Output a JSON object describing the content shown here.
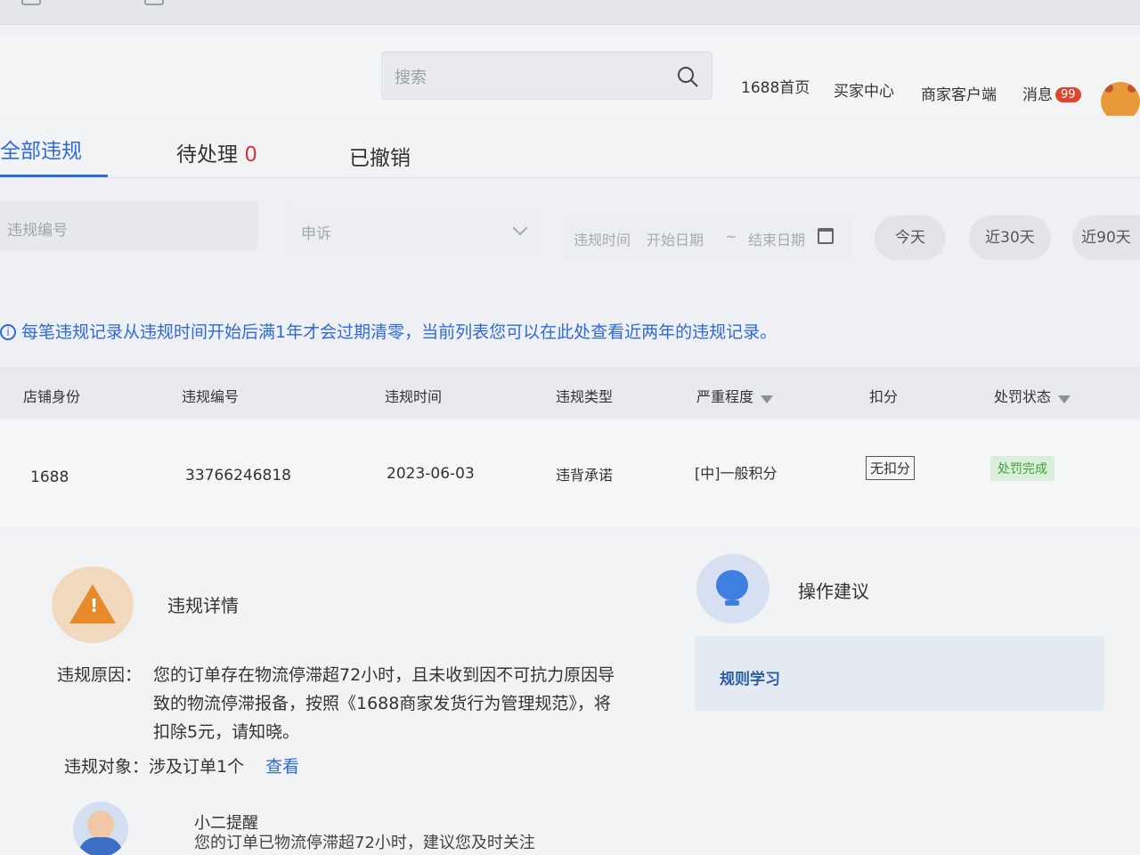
{
  "header": {
    "search_placeholder": "搜索",
    "nav": [
      "1688首页",
      "买家中心",
      "商家客户端",
      "消息"
    ],
    "message_badge": "99"
  },
  "tabs": {
    "all": "全部违规",
    "pending": "待处理",
    "pending_count": "0",
    "revoked": "已撤销"
  },
  "filters": {
    "violation_no_placeholder": "违规编号",
    "appeal_placeholder": "申诉",
    "date_label": "违规时间",
    "start_date": "开始日期",
    "separator": "~",
    "end_date": "结束日期",
    "quick": [
      "今天",
      "近30天",
      "近90天"
    ]
  },
  "notice": "每笔违规记录从违规时间开始后满1年才会过期清零，当前列表您可以在此处查看近两年的违规记录。",
  "table": {
    "columns": [
      "店铺身份",
      "违规编号",
      "违规时间",
      "违规类型",
      "严重程度",
      "扣分",
      "处罚状态"
    ],
    "row": {
      "shop": "1688",
      "violation_no": "33766246818",
      "time": "2023-06-03",
      "type": "违背承诺",
      "severity": "[中]一般积分",
      "score": "无扣分",
      "status": "处罚完成"
    }
  },
  "details": {
    "title": "违规详情",
    "reason_label": "违规原因：",
    "reason_text": "您的订单存在物流停滞超72小时，且未收到因不可抗力原因导致的物流停滞报备，按照《1688商家发货行为管理规范》，将扣除5元，请知晓。",
    "target_label": "违规对象：涉及订单1个",
    "view_link": "查看",
    "suggestion_title": "操作建议",
    "rule_study": "规则学习",
    "reminder_title": "小二提醒",
    "reminder_text": "您的订单已物流停滞超72小时，建议您及时关注"
  }
}
